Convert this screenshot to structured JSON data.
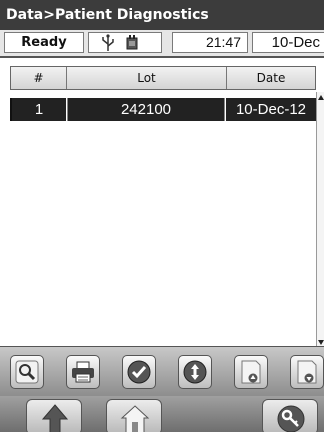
{
  "window": {
    "title": "Data>Patient Diagnostics"
  },
  "status": {
    "state": "Ready",
    "time": "21:47",
    "date": "10-Dec",
    "icons": [
      "usb-icon",
      "battery-plug-icon"
    ]
  },
  "table": {
    "columns": [
      "#",
      "Lot",
      "Date"
    ],
    "rows": [
      {
        "num": "1",
        "lot": "242100",
        "date": "10-Dec-12",
        "selected": true
      }
    ]
  },
  "toolbar": {
    "buttons": [
      "search-icon",
      "print-icon",
      "checkmark-icon",
      "up-down-icon",
      "page-up-icon",
      "page-down-icon"
    ]
  },
  "navbar": {
    "buttons": [
      "back-arrow-icon",
      "home-icon",
      "key-icon"
    ]
  },
  "colors": {
    "title_bg": "#3c3c3c",
    "selected_row": "#222222",
    "toolbar_bg": "#a8a8a8"
  }
}
